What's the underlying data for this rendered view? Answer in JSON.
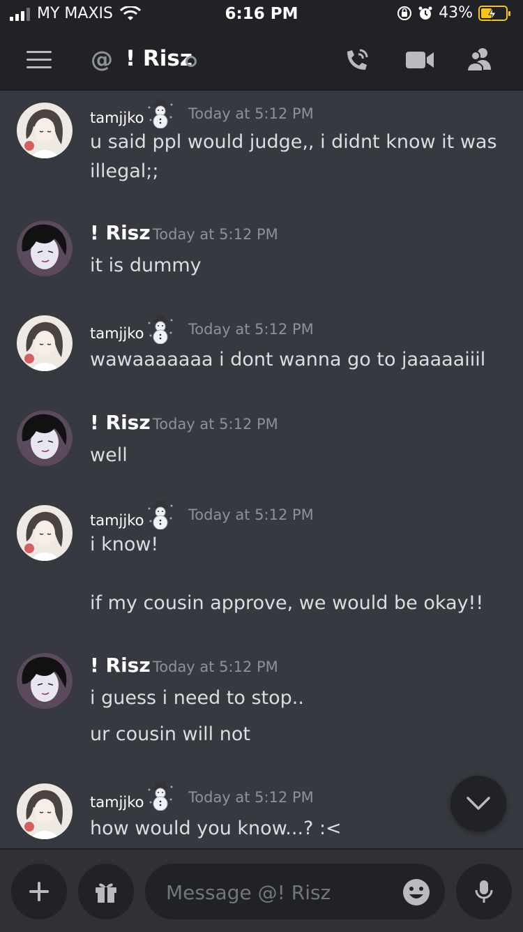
{
  "status_bar": {
    "carrier": "MY MAXIS",
    "time": "6:16 PM",
    "battery": "43%",
    "battery_color": "#f5c518"
  },
  "header": {
    "at_symbol": "@",
    "channel_name": "! Risz",
    "icons": [
      "hamburger-icon",
      "call-icon",
      "video-icon",
      "members-icon"
    ]
  },
  "messages": [
    {
      "author": "tamjjko",
      "badge": "snowman-icon",
      "timestamp": "Today at 5:12 PM",
      "lines": [
        "u said ppl would judge,, i didnt know it was illegal;;"
      ]
    },
    {
      "author": "! Risz",
      "timestamp": "Today at 5:12 PM",
      "lines": [
        "it is dummy"
      ]
    },
    {
      "author": "tamjjko",
      "badge": "snowman-icon",
      "timestamp": "Today at 5:12 PM",
      "lines": [
        "wawaaaaaaa i dont wanna go to jaaaaaiiil"
      ]
    },
    {
      "author": "! Risz",
      "timestamp": "Today at 5:12 PM",
      "lines": [
        "well"
      ]
    },
    {
      "author": "tamjjko",
      "badge": "snowman-icon",
      "timestamp": "Today at 5:12 PM",
      "lines": [
        "i know!",
        "if my cousin approve, we would be okay!!"
      ]
    },
    {
      "author": "! Risz",
      "timestamp": "Today at 5:12 PM",
      "lines": [
        "i guess i need to stop..",
        "ur cousin will not"
      ]
    },
    {
      "author": "tamjjko",
      "badge": "snowman-icon",
      "timestamp": "Today at 5:12 PM",
      "lines": [
        "how would you know...? :<"
      ]
    }
  ],
  "composer": {
    "placeholder": "Message @! Risz",
    "icons": [
      "plus-icon",
      "gift-icon",
      "emoji-icon",
      "microphone-icon"
    ]
  },
  "colors": {
    "background": "#36393f",
    "header_bg": "#202225",
    "text": "#dcddde",
    "muted": "#8e9297"
  }
}
